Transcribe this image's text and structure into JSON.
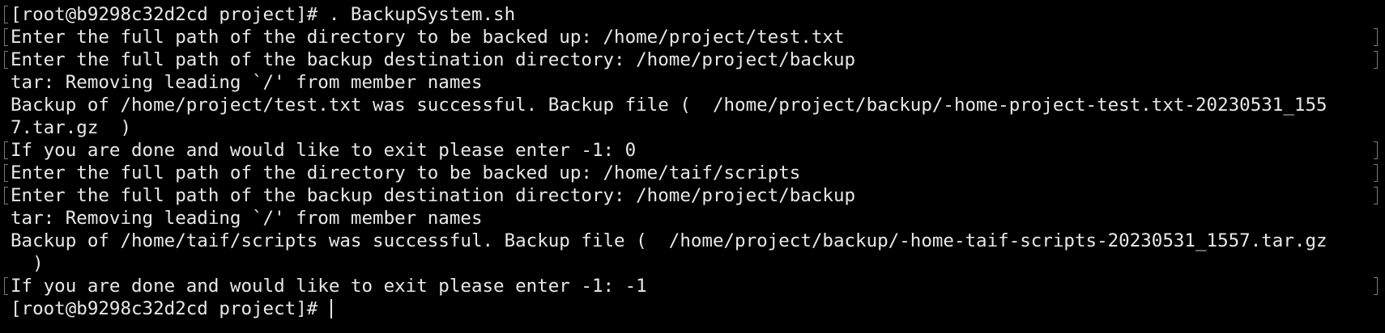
{
  "terminal": {
    "lines": [
      {
        "text": "[root@b9298c32d2cd project]# . BackupSystem.sh",
        "bl": true,
        "br": false
      },
      {
        "text": "Enter the full path of the directory to be backed up: /home/project/test.txt",
        "bl": true,
        "br": true
      },
      {
        "text": "Enter the full path of the backup destination directory: /home/project/backup",
        "bl": true,
        "br": true
      },
      {
        "text": "tar: Removing leading `/' from member names",
        "bl": false,
        "br": false
      },
      {
        "text": "Backup of /home/project/test.txt was successful. Backup file (  /home/project/backup/-home-project-test.txt-20230531_155",
        "bl": false,
        "br": false
      },
      {
        "text": "7.tar.gz  )",
        "bl": false,
        "br": false
      },
      {
        "text": "If you are done and would like to exit please enter -1: 0",
        "bl": true,
        "br": true
      },
      {
        "text": "Enter the full path of the directory to be backed up: /home/taif/scripts",
        "bl": true,
        "br": true
      },
      {
        "text": "Enter the full path of the backup destination directory: /home/project/backup",
        "bl": true,
        "br": true
      },
      {
        "text": "tar: Removing leading `/' from member names",
        "bl": false,
        "br": false
      },
      {
        "text": "Backup of /home/taif/scripts was successful. Backup file (  /home/project/backup/-home-taif-scripts-20230531_1557.tar.gz",
        "bl": false,
        "br": false
      },
      {
        "text": "  )",
        "bl": false,
        "br": false
      },
      {
        "text": "If you are done and would like to exit please enter -1: -1",
        "bl": true,
        "br": true
      }
    ],
    "prompt": "[root@b9298c32d2cd project]# "
  }
}
